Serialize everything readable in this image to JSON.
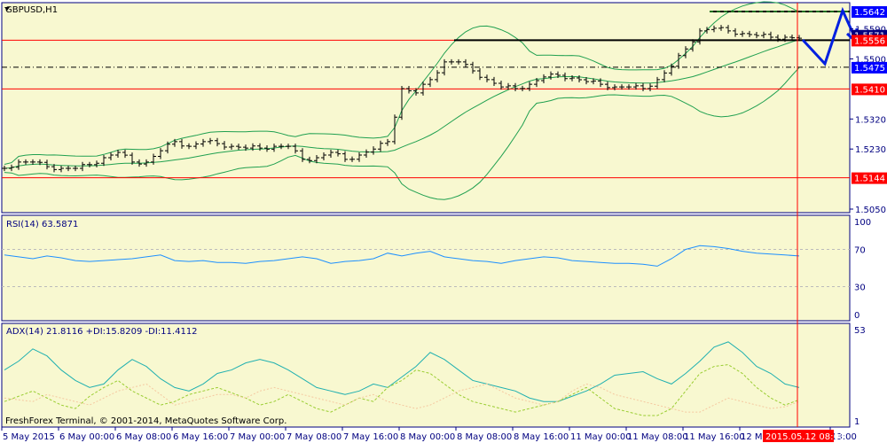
{
  "window": {
    "symbol_title": "GBPUSD,H1",
    "copyright": "FreshForex Terminal, © 2001-2014, MetaQuotes Software Corp."
  },
  "colors": {
    "bg": "#f8f8d0",
    "axis": "#000080",
    "bands": "#20a050",
    "rsi": "#1e90ff",
    "adx": "#20b0b0",
    "plus_di": "#9acd32",
    "minus_di": "#f5c8a0",
    "red": "#ff0000",
    "forecast": "#0020e0"
  },
  "chart_data": [
    {
      "type": "line",
      "name": "GBPUSD H1 price",
      "ylim": [
        1.505,
        1.5642
      ],
      "y_ticks": [
        "1.5590",
        "1.5500",
        "1.5320",
        "1.5230",
        "1.5050"
      ],
      "price_labels": [
        {
          "text": "1.5642",
          "color": "#0000ff"
        },
        {
          "text": "1.5571",
          "color": "#000080"
        },
        {
          "text": "1.5556",
          "color": "#ff0000"
        },
        {
          "text": "1.5475",
          "color": "#0000ff"
        },
        {
          "text": "1.5410",
          "color": "#ff0000"
        },
        {
          "text": "1.5144",
          "color": "#ff0000"
        }
      ],
      "levels": {
        "resistance": 1.5642,
        "pivot": 1.5556,
        "support": 1.5475,
        "red_lines": [
          1.5556,
          1.541,
          1.5144
        ]
      },
      "x_ticks": [
        "5 May 2015",
        "6 May 00:00",
        "6 May 08:00",
        "6 May 16:00",
        "7 May 00:00",
        "7 May 08:00",
        "7 May 16:00",
        "8 May 00:00",
        "8 May 08:00",
        "8 May 16:00",
        "11 May 00:00",
        "11 May 08:00",
        "11 May 16:00",
        "12 Ma",
        "13:00"
      ],
      "cursor_label": "2015.05.12 08:00",
      "closes": [
        1.5172,
        1.5191,
        1.5191,
        1.5177,
        1.5172,
        1.5172,
        1.5183,
        1.5204,
        1.522,
        1.5191,
        1.5191,
        1.5225,
        1.5252,
        1.5238,
        1.5252,
        1.5246,
        1.5238,
        1.5233,
        1.5233,
        1.5238,
        1.5238,
        1.5199,
        1.5204,
        1.522,
        1.5199,
        1.5212,
        1.523,
        1.5252,
        1.5411,
        1.5398,
        1.5438,
        1.5491,
        1.5491,
        1.5464,
        1.5438,
        1.5416,
        1.5411,
        1.5424,
        1.5446,
        1.5451,
        1.5443,
        1.5432,
        1.5424,
        1.5416,
        1.5416,
        1.5411,
        1.5438,
        1.5478,
        1.553,
        1.5584,
        1.5592,
        1.5584,
        1.5576,
        1.557,
        1.5565,
        1.5565,
        1.5562
      ]
    },
    {
      "type": "line",
      "name": "RSI",
      "title": "RSI(14) 63.5871",
      "ylim": [
        0,
        100
      ],
      "y_ticks": [
        "100",
        "70",
        "30",
        "0"
      ],
      "values": [
        64,
        62,
        60,
        63,
        61,
        58,
        57,
        58,
        59,
        60,
        62,
        64,
        58,
        57,
        58,
        56,
        56,
        55,
        57,
        58,
        60,
        62,
        60,
        55,
        57,
        58,
        60,
        66,
        63,
        66,
        68,
        62,
        60,
        58,
        57,
        55,
        58,
        60,
        62,
        61,
        58,
        57,
        56,
        55,
        55,
        54,
        52,
        60,
        70,
        74,
        73,
        71,
        68,
        66,
        65,
        64,
        63
      ]
    },
    {
      "type": "line",
      "name": "ADX",
      "title": "ADX(14) 21.8116 +DI:15.8209 -DI:11.4112",
      "ylim": [
        1,
        53
      ],
      "y_ticks": [
        "53",
        "1"
      ],
      "series": [
        {
          "name": "ADX",
          "values": [
            30,
            35,
            42,
            38,
            30,
            24,
            20,
            22,
            30,
            36,
            32,
            25,
            20,
            18,
            22,
            28,
            30,
            34,
            36,
            34,
            30,
            25,
            20,
            18,
            16,
            18,
            22,
            20,
            26,
            32,
            40,
            36,
            30,
            24,
            22,
            20,
            18,
            14,
            12,
            12,
            15,
            18,
            22,
            27,
            28,
            29,
            25,
            22,
            28,
            35,
            43,
            46,
            40,
            32,
            28,
            22,
            20
          ]
        },
        {
          "name": "+DI",
          "values": [
            12,
            15,
            18,
            14,
            10,
            8,
            15,
            20,
            24,
            18,
            14,
            10,
            12,
            16,
            18,
            20,
            17,
            14,
            10,
            12,
            16,
            12,
            8,
            6,
            10,
            14,
            12,
            20,
            24,
            30,
            28,
            22,
            16,
            12,
            10,
            8,
            6,
            8,
            10,
            12,
            16,
            20,
            14,
            8,
            6,
            4,
            4,
            8,
            18,
            28,
            32,
            33,
            28,
            20,
            14,
            10,
            13
          ]
        },
        {
          "name": "-DI",
          "values": [
            14,
            13,
            12,
            16,
            14,
            12,
            10,
            14,
            18,
            20,
            22,
            16,
            10,
            12,
            14,
            16,
            16,
            14,
            18,
            20,
            18,
            16,
            14,
            12,
            10,
            14,
            16,
            12,
            10,
            8,
            10,
            14,
            18,
            20,
            22,
            18,
            14,
            12,
            10,
            12,
            18,
            22,
            20,
            16,
            14,
            12,
            10,
            8,
            6,
            6,
            10,
            14,
            12,
            10,
            8,
            9,
            12
          ]
        }
      ]
    }
  ]
}
